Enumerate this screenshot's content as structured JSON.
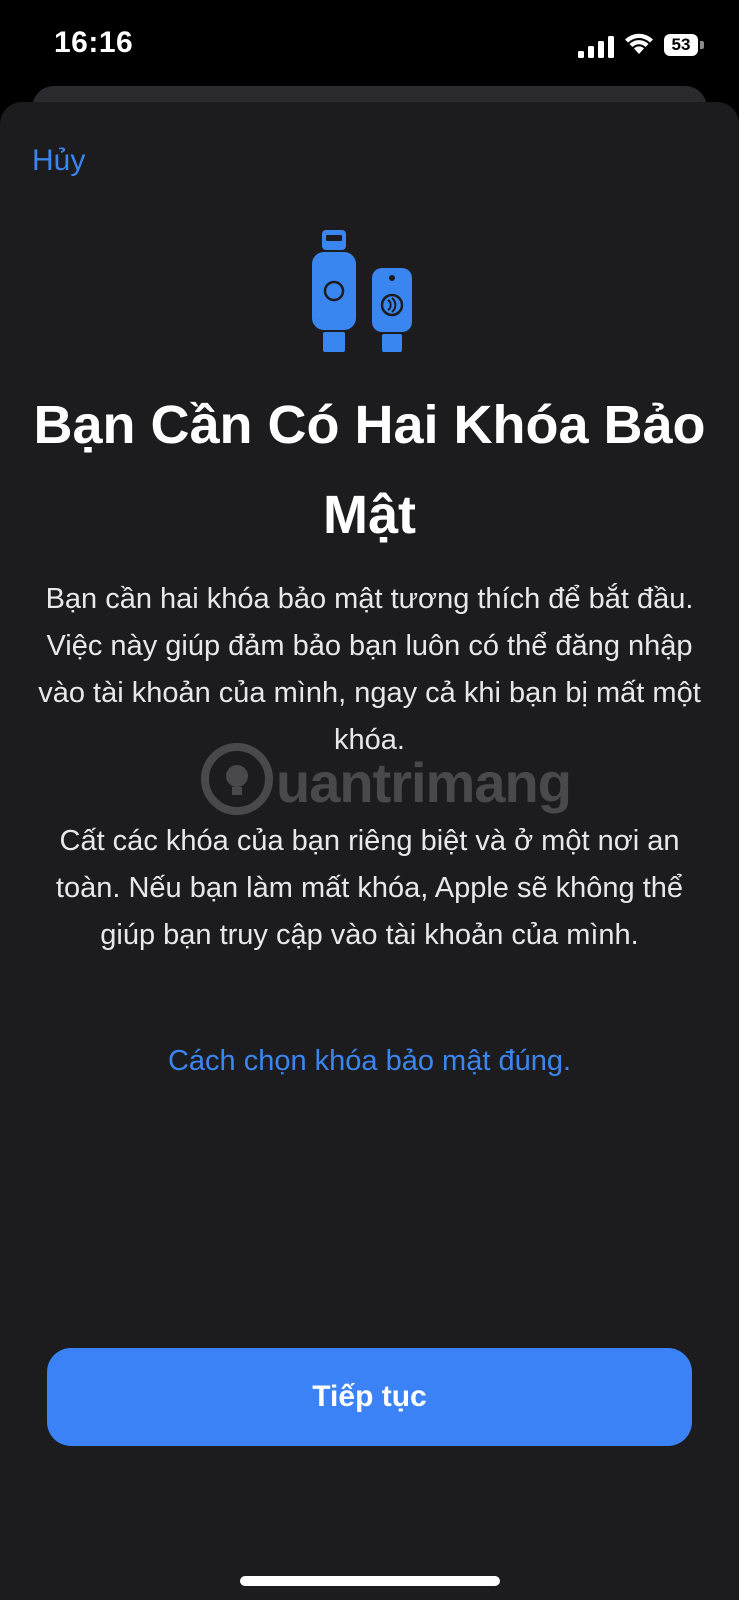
{
  "status_bar": {
    "time": "16:16",
    "battery_level": "53",
    "icons": [
      "signal-bars-icon",
      "wifi-icon",
      "battery-icon"
    ]
  },
  "sheet": {
    "cancel_label": "Hủy",
    "illustration_icon": "security-keys-icon",
    "title": "Bạn Cần Có Hai Khóa Bảo Mật",
    "paragraph_1": "Bạn cần hai khóa bảo mật tương thích để bắt đầu. Việc này giúp đảm bảo bạn luôn có thể đăng nhập vào tài khoản của mình, ngay cả khi bạn bị mất một khóa.",
    "paragraph_2": "Cất các khóa của bạn riêng biệt và ở một nơi an toàn. Nếu bạn làm mất khóa, Apple sẽ không thể giúp bạn truy cập vào tài khoản của mình.",
    "help_link": "Cách chọn khóa bảo mật đúng.",
    "continue_label": "Tiếp tục"
  },
  "watermark": {
    "text": "uantrimang"
  },
  "colors": {
    "accent": "#3a86f0",
    "button": "#3a82f6",
    "sheet_background": "#1c1c1e"
  }
}
